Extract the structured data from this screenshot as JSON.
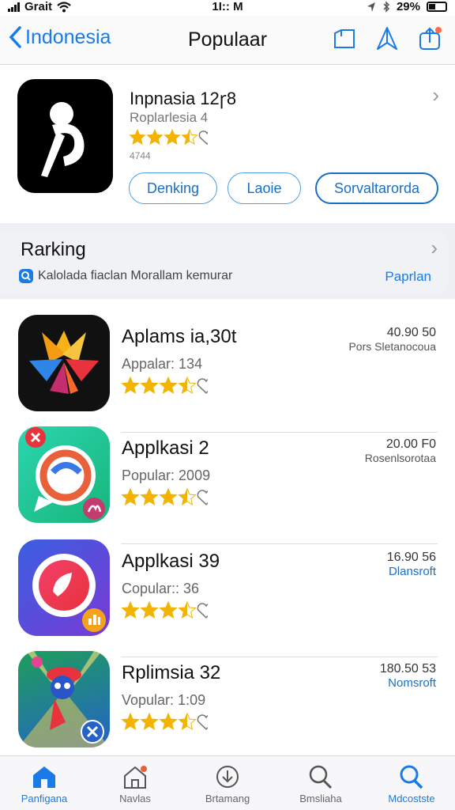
{
  "status_bar": {
    "carrier": "Grait",
    "time": "1Ӏ:: M",
    "battery": "29%"
  },
  "nav": {
    "back_label": "Indonesia",
    "title": "Populaar",
    "icon_names": [
      "bookmark-icon",
      "share-arrow-icon",
      "upload-icon"
    ]
  },
  "featured": {
    "title": "Inpnasia 12ꞅ8",
    "subtitle": "Roplarlesia  4",
    "rating": 3.5,
    "mini": "4744",
    "buttons": [
      "Denking",
      "Laoie",
      "Sorvaltarorda"
    ]
  },
  "ranking": {
    "title": "Rarking",
    "subtitle": "Kalolada fiaclan  Morallam kemurar",
    "link": "Paprlan"
  },
  "apps": [
    {
      "name": "Aplams ia,30t",
      "sub": "Appalar: 134",
      "rating": 3.5,
      "price": "40.90 50",
      "note": "Pors Sletanocoua",
      "note_style": "gray",
      "icon": "flower-app-icon"
    },
    {
      "name": "Applkasi 2",
      "sub": "Popular: 2009",
      "rating": 3.5,
      "price": "20.00 F0",
      "note": "Rosenlsorotaa",
      "note_style": "gray",
      "icon": "chat-app-icon"
    },
    {
      "name": "Applkasi 39",
      "sub": "Copular:: 36",
      "rating": 3.5,
      "price": "16.90 56",
      "note": "Dlansroft",
      "note_style": "blue",
      "icon": "record-app-icon"
    },
    {
      "name": "Rplimsia 32",
      "sub": "Vopular: 1:09",
      "rating": 3.5,
      "price": "180.50 53",
      "note": "Nomsroft",
      "note_style": "blue",
      "icon": "game-app-icon"
    }
  ],
  "tabs": [
    {
      "label": "Panfigana",
      "icon": "home-icon",
      "active": true
    },
    {
      "label": "Navlas",
      "icon": "house-badge-icon",
      "active": false
    },
    {
      "label": "Brtamang",
      "icon": "download-icon",
      "active": false
    },
    {
      "label": "Bmsliaha",
      "icon": "search-icon",
      "active": false
    },
    {
      "label": "Mdcostste",
      "icon": "search-icon",
      "active": true
    }
  ],
  "colors": {
    "accent": "#1a7ae6",
    "star": "#f2b400",
    "divider": "#dddddd"
  }
}
